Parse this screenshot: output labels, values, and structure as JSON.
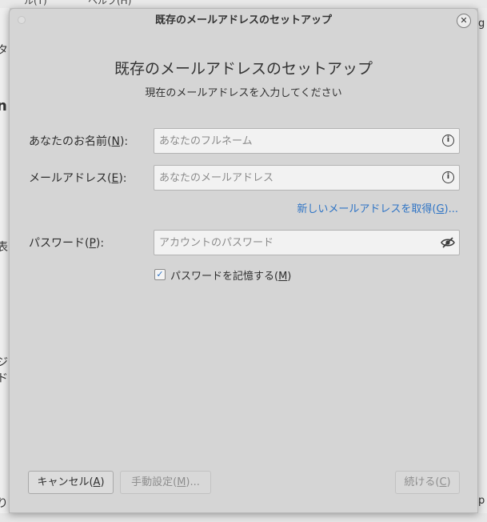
{
  "background": {
    "menubar": {
      "items": [
        "ル(T)",
        "ヘルプ(H)"
      ]
    },
    "left_fragments": [
      "タ",
      "n",
      "表",
      "ジ",
      "ド",
      "り"
    ],
    "right_fragments": [
      "g",
      "p"
    ]
  },
  "dialog": {
    "title": "既存のメールアドレスのセットアップ",
    "heading": "既存のメールアドレスのセットアップ",
    "subheading": "現在のメールアドレスを入力してください",
    "name_field": {
      "label": "あなたのお名前(",
      "mnemonic": "N",
      "label_suffix": "):",
      "placeholder": "あなたのフルネーム",
      "value": "",
      "icon": "info-icon"
    },
    "email_field": {
      "label": "メールアドレス(",
      "mnemonic": "E",
      "label_suffix": "):",
      "placeholder": "あなたのメールアドレス",
      "value": "",
      "icon": "info-icon"
    },
    "new_address_link": {
      "label": "新しいメールアドレスを取得(",
      "mnemonic": "G",
      "suffix": ")..."
    },
    "password_field": {
      "label": "パスワード(",
      "mnemonic": "P",
      "label_suffix": "):",
      "placeholder": "アカウントのパスワード",
      "value": "",
      "icon": "eye-slash-icon"
    },
    "remember_password": {
      "checked": true,
      "label": "パスワードを記憶する(",
      "mnemonic": "M",
      "suffix": ")"
    },
    "buttons": {
      "cancel": {
        "label": "キャンセル(",
        "mnemonic": "A",
        "suffix": ")"
      },
      "manual": {
        "label": "手動設定(",
        "mnemonic": "M",
        "suffix": ")..."
      },
      "continue": {
        "label": "続ける(",
        "mnemonic": "C",
        "suffix": ")"
      }
    }
  }
}
